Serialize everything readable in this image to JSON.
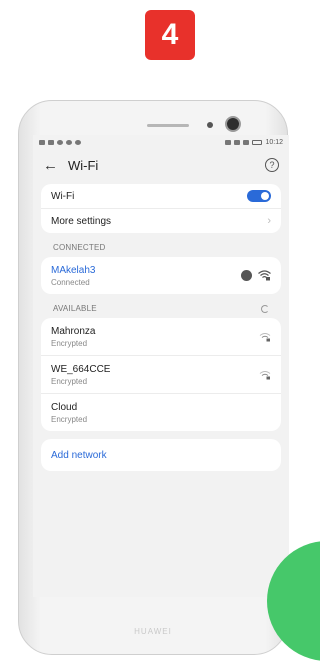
{
  "step_badge": "4",
  "status_bar": {
    "time": "10:12"
  },
  "app_bar": {
    "back_icon": "arrow-left-icon",
    "title": "Wi-Fi",
    "help_icon": "help-icon"
  },
  "settings": {
    "wifi_label": "Wi-Fi",
    "wifi_enabled": true,
    "more_settings_label": "More settings"
  },
  "connected": {
    "section_label": "CONNECTED",
    "network": {
      "name": "MAkelah3",
      "status": "Connected"
    }
  },
  "available": {
    "section_label": "AVAILABLE",
    "networks": [
      {
        "name": "Mahronza",
        "status": "Encrypted"
      },
      {
        "name": "WE_664CCE",
        "status": "Encrypted"
      },
      {
        "name": "Cloud",
        "status": "Encrypted"
      }
    ]
  },
  "add_network_label": "Add network",
  "brand": "HUAWEI",
  "colors": {
    "accent": "#2a6ad8",
    "badge": "#e8312b",
    "overlay": "#46c86a"
  }
}
